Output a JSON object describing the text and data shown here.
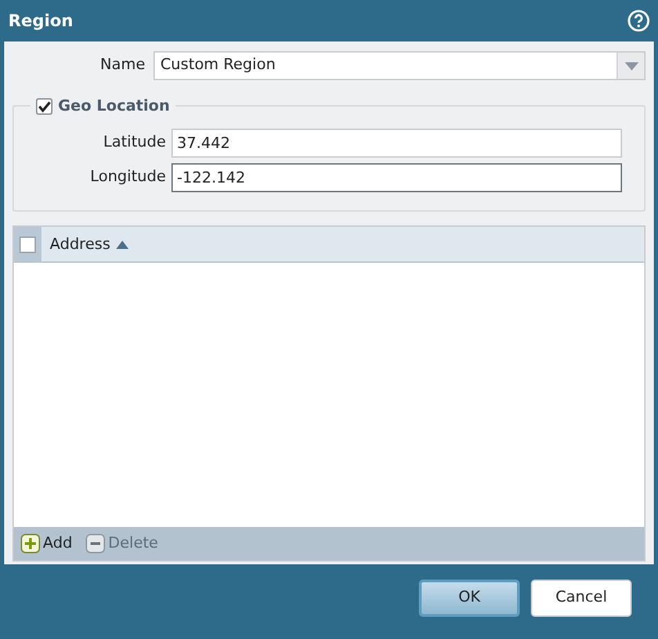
{
  "window": {
    "title": "Region"
  },
  "name_field": {
    "label": "Name",
    "value": "Custom Region"
  },
  "geo_location": {
    "label": "Geo Location",
    "checked": true,
    "fields": [
      {
        "label": "Latitude",
        "value": "37.442"
      },
      {
        "label": "Longitude",
        "value": "-122.142"
      }
    ]
  },
  "table": {
    "select_all_checked": false,
    "columns": [
      {
        "label": "Address",
        "sorted": true
      }
    ]
  },
  "toolbar": [
    {
      "label": "Add",
      "kind": "add",
      "disabled": false
    },
    {
      "label": "Delete",
      "kind": "delete",
      "disabled": true
    }
  ],
  "buttons": [
    {
      "label": "OK",
      "default": true
    },
    {
      "label": "Cancel",
      "default": false
    }
  ]
}
